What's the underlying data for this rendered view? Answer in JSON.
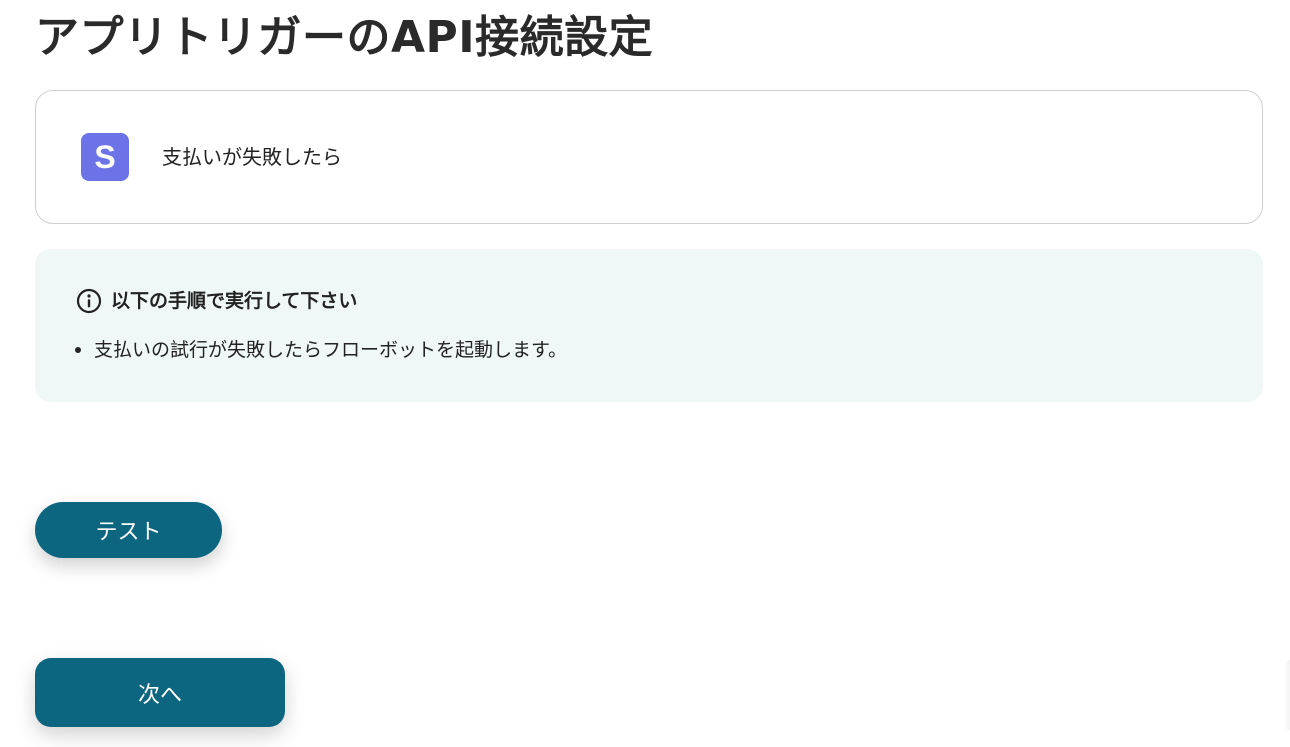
{
  "page": {
    "title": "アプリトリガーのAPI接続設定"
  },
  "trigger": {
    "app_icon_letter": "S",
    "app_icon_color": "#6b73e6",
    "label": "支払いが失敗したら"
  },
  "notice": {
    "icon": "info-icon",
    "title": "以下の手順で実行して下さい",
    "items": [
      "支払いの試行が失敗したらフローボットを起動します。"
    ],
    "background_color": "#eff8f6"
  },
  "buttons": {
    "test_label": "テスト",
    "next_label": "次へ",
    "primary_color": "#0d6680"
  }
}
